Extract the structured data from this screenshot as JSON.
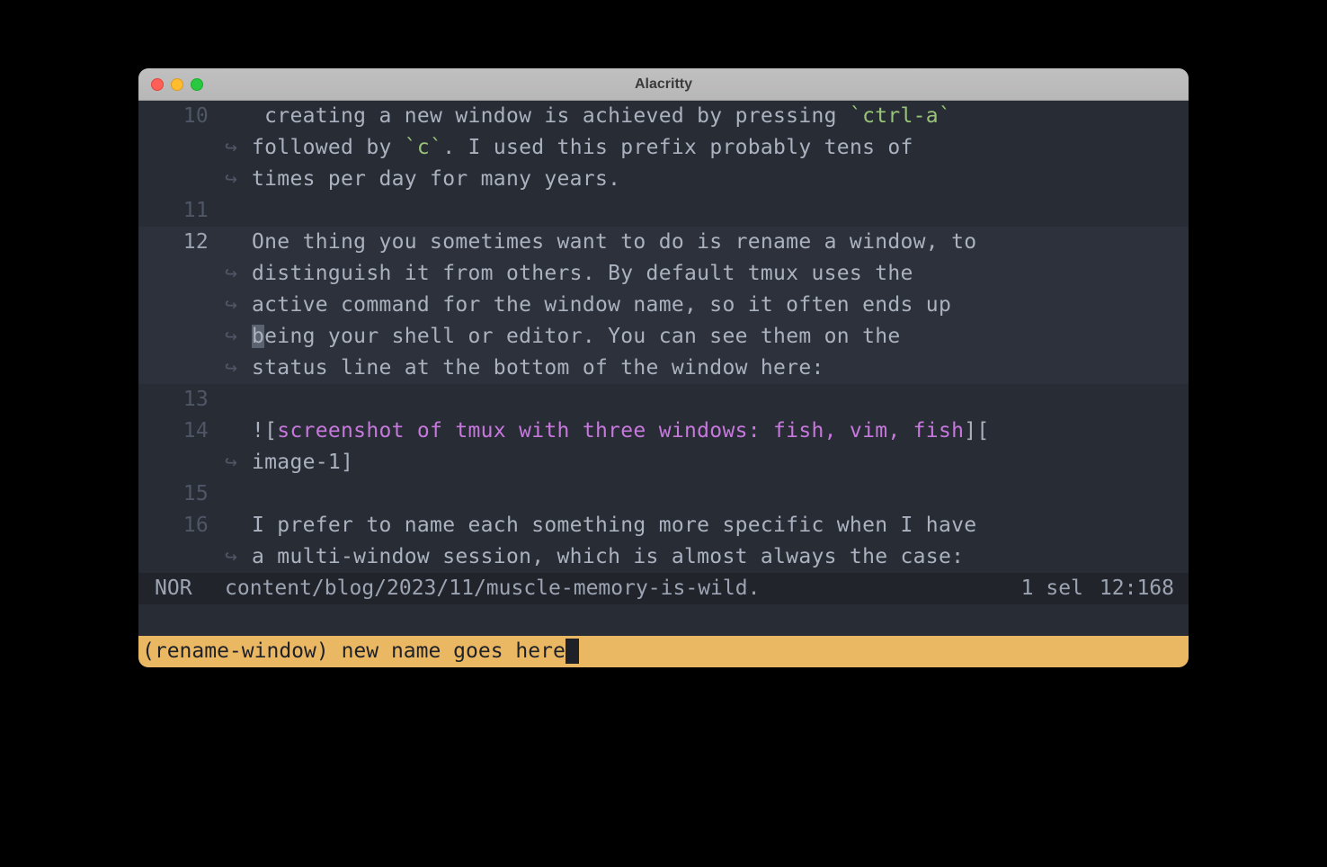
{
  "window": {
    "title": "Alacritty"
  },
  "lines": [
    {
      "num": "10",
      "wrap": false,
      "segments": [
        {
          "t": " creating a new window is achieved by pressing ",
          "cls": ""
        },
        {
          "t": "`ctrl-a`",
          "cls": "green"
        }
      ]
    },
    {
      "num": "",
      "wrap": true,
      "segments": [
        {
          "t": "followed by ",
          "cls": ""
        },
        {
          "t": "`c`",
          "cls": "green"
        },
        {
          "t": ". I used this prefix probably tens of",
          "cls": ""
        }
      ]
    },
    {
      "num": "",
      "wrap": true,
      "segments": [
        {
          "t": "times per day for many years.",
          "cls": ""
        }
      ]
    },
    {
      "num": "11",
      "wrap": false,
      "segments": []
    },
    {
      "num": "12",
      "wrap": false,
      "current": true,
      "hl": true,
      "segments": [
        {
          "t": "One thing you sometimes want to do is rename a window, to",
          "cls": ""
        }
      ]
    },
    {
      "num": "",
      "wrap": true,
      "hl": true,
      "segments": [
        {
          "t": "distinguish it from others. By default tmux uses the",
          "cls": ""
        }
      ]
    },
    {
      "num": "",
      "wrap": true,
      "hl": true,
      "segments": [
        {
          "t": "active command for the window name, so it often ends up",
          "cls": ""
        }
      ]
    },
    {
      "num": "",
      "wrap": true,
      "hl": true,
      "cursor_at": 0,
      "segments": [
        {
          "t": "being your shell or editor. You can see them on the",
          "cls": ""
        }
      ]
    },
    {
      "num": "",
      "wrap": true,
      "hl": true,
      "segments": [
        {
          "t": "status line at the bottom of the window here:",
          "cls": ""
        }
      ]
    },
    {
      "num": "13",
      "wrap": false,
      "segments": []
    },
    {
      "num": "14",
      "wrap": false,
      "segments": [
        {
          "t": "![",
          "cls": ""
        },
        {
          "t": "screenshot of tmux with three windows: fish, vim, fish",
          "cls": "purple"
        },
        {
          "t": "][",
          "cls": ""
        }
      ]
    },
    {
      "num": "",
      "wrap": true,
      "segments": [
        {
          "t": "image-1]",
          "cls": ""
        }
      ]
    },
    {
      "num": "15",
      "wrap": false,
      "segments": []
    },
    {
      "num": "16",
      "wrap": false,
      "segments": [
        {
          "t": "I prefer to name each something more specific when I have",
          "cls": ""
        }
      ]
    },
    {
      "num": "",
      "wrap": true,
      "segments": [
        {
          "t": "a multi-window session, which is almost always the case:",
          "cls": ""
        }
      ]
    }
  ],
  "statusline": {
    "mode": "NOR",
    "file": "content/blog/2023/11/muscle-memory-is-wild.",
    "sel": "1 sel",
    "pos": "12:168"
  },
  "tmux_prompt": {
    "label": "(rename-window) ",
    "input": "new name goes here"
  },
  "wrap_glyph": "↪"
}
